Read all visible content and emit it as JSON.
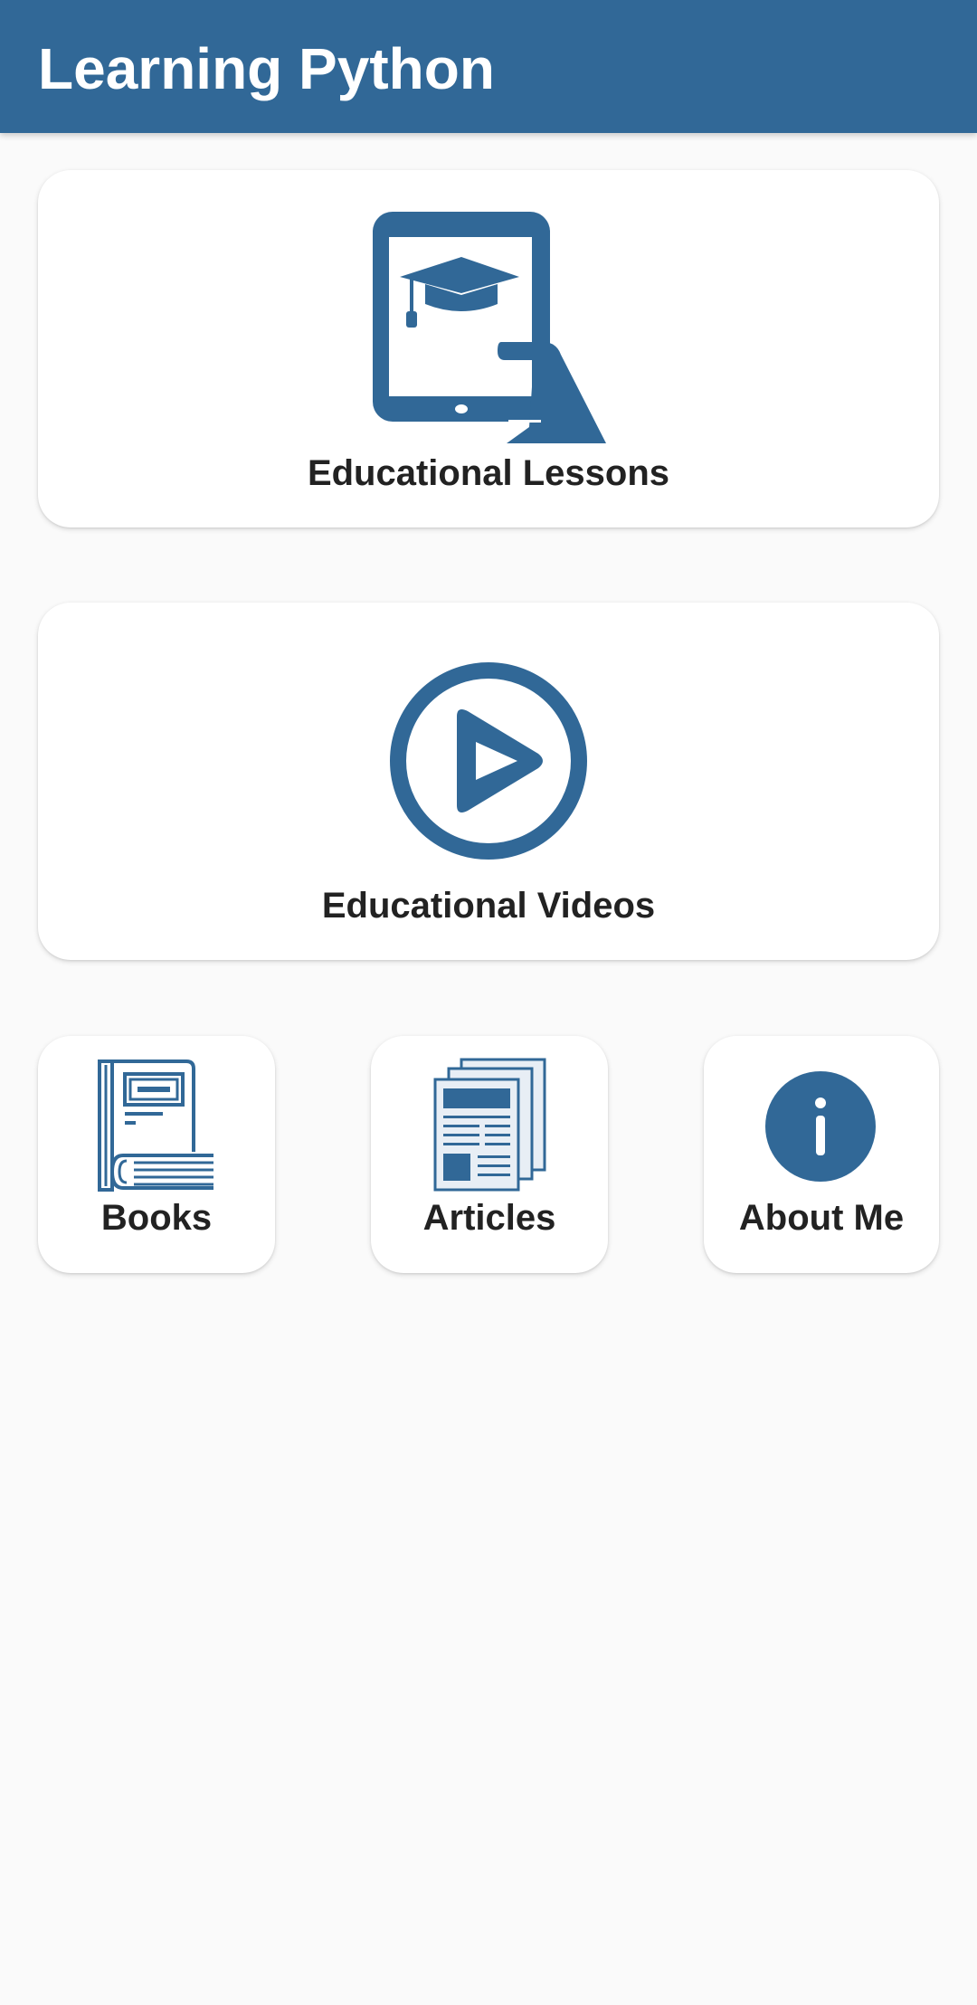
{
  "app": {
    "title": "Learning Python",
    "accent_color": "#316897"
  },
  "cards": {
    "lessons": {
      "label": "Educational Lessons",
      "icon": "tablet-graduation-cap-icon"
    },
    "videos": {
      "label": "Educational Videos",
      "icon": "play-circle-icon"
    },
    "books": {
      "label": "Books",
      "icon": "book-icon"
    },
    "articles": {
      "label": "Articles",
      "icon": "newspaper-icon"
    },
    "about": {
      "label": "About Me",
      "icon": "info-icon"
    }
  }
}
